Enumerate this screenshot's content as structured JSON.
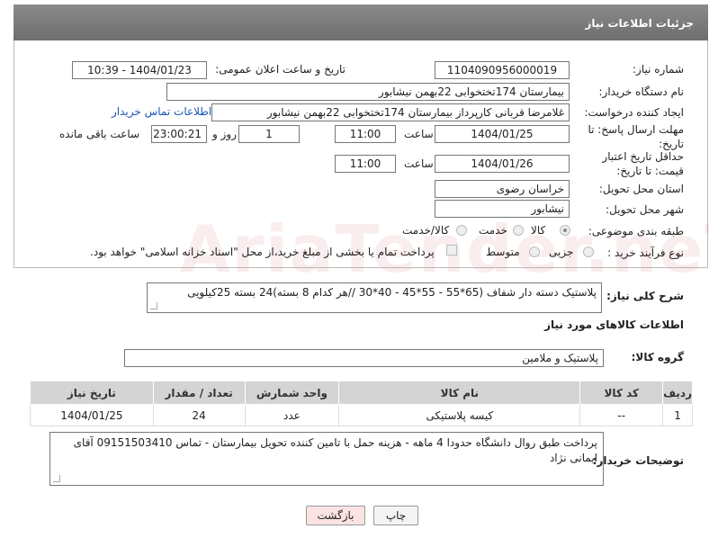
{
  "header": {
    "title": "جزئیات اطلاعات نیاز"
  },
  "form": {
    "need_number_label": "شماره نیاز:",
    "need_number": "1104090956000019",
    "announce_label": "تاریخ و ساعت اعلان عمومی:",
    "announce_value": "1404/01/23 - 10:39",
    "buyer_org_label": "نام دستگاه خریدار:",
    "buyer_org": "بیمارستان 174تختخوابی 22بهمن نیشابور",
    "creator_label": "ایجاد کننده درخواست:",
    "creator": "غلامرضا قربانی کارپرداز بیمارستان 174تختخوابی 22بهمن نیشابور",
    "contact_link": "اطلاعات تماس خریدار",
    "reply_deadline_label": "مهلت ارسال پاسخ: تا تاریخ:",
    "reply_date": "1404/01/25",
    "time_label": "ساعت",
    "reply_time": "11:00",
    "days_value": "1",
    "days_label": "روز و",
    "remaining_time": "23:00:21",
    "remaining_label": "ساعت باقی مانده",
    "price_deadline_label": "حداقل تاریخ اعتبار قیمت: تا تاریخ:",
    "price_date": "1404/01/26",
    "price_time": "11:00",
    "province_label": "استان محل تحویل:",
    "province": "خراسان رضوی",
    "city_label": "شهر محل تحویل:",
    "city": "نیشابور",
    "category_label": "طبقه بندی موضوعی:",
    "category_options": [
      "کالا",
      "خدمت",
      "کالا/خدمت"
    ],
    "process_label": "نوع فرآیند خرید :",
    "process_options": [
      "جزیی",
      "متوسط"
    ],
    "payment_note": "پرداخت تمام یا بخشی از مبلغ خرید،از محل \"اسناد خزانه اسلامی\" خواهد بود."
  },
  "description": {
    "label": "شرح کلی نیاز:",
    "value": "پلاستیک دسته دار شفاف (65*55 - 55*45 - 40*30 //هر کدام 8 بسته)24 بسته 25کیلویی"
  },
  "goods": {
    "section_title": "اطلاعات کالاهای مورد نیاز",
    "group_label": "گروه کالا:",
    "group_value": "پلاستیک و ملامین",
    "columns": [
      "ردیف",
      "کد کالا",
      "نام کالا",
      "واحد شمارش",
      "تعداد / مقدار",
      "تاریخ نیاز"
    ],
    "rows": [
      {
        "row": "1",
        "code": "--",
        "name": "کیسه پلاستیکی",
        "unit": "عدد",
        "qty": "24",
        "date": "1404/01/25"
      }
    ]
  },
  "buyer_notes": {
    "label": "توضیحات خریدار:",
    "value": "پرداخت طبق روال دانشگاه حدودا 4 ماهه - هزینه حمل با تامین کننده تحویل بیمارستان - تماس 09151503410 آقای ایمانی نژاد"
  },
  "buttons": {
    "print": "چاپ",
    "back": "بازگشت"
  },
  "watermark": "AriaTender.neT"
}
